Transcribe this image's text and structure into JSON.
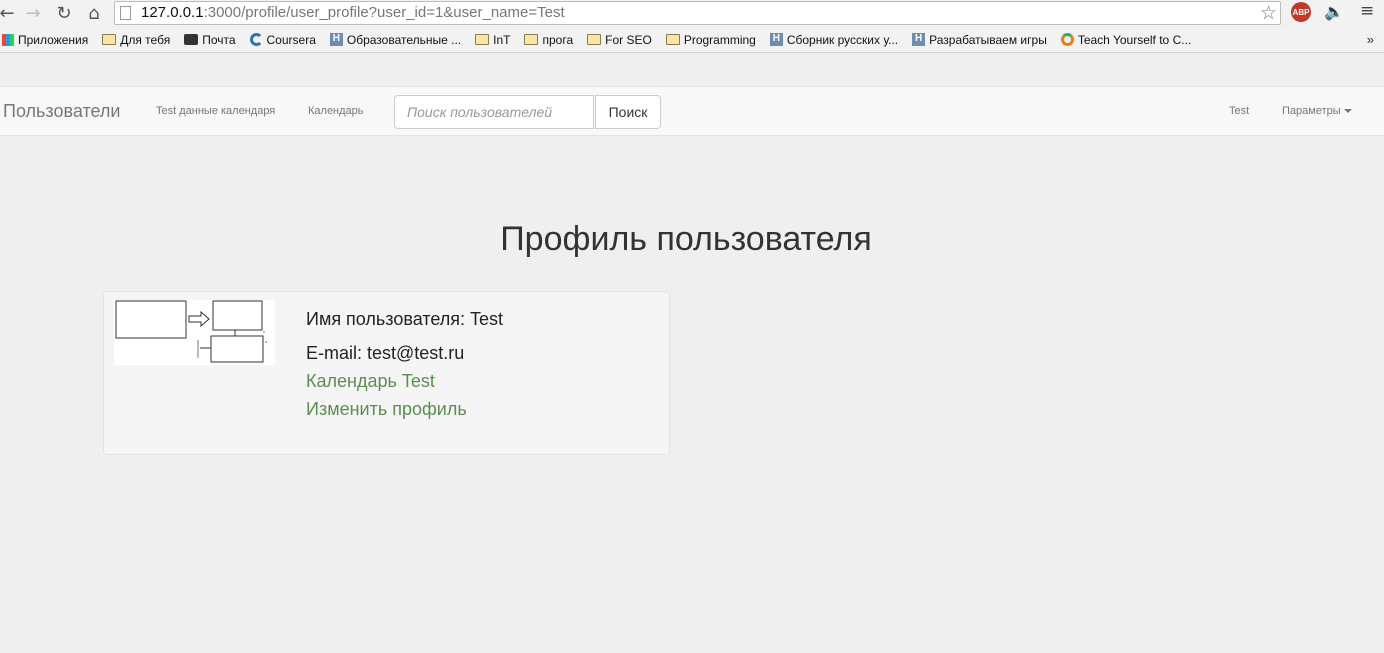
{
  "browser": {
    "url_host": "127.0.0.1",
    "url_rest": ":3000/profile/user_profile?user_id=1&user_name=Test",
    "abp_label": "ABP",
    "more_label": "»",
    "bookmarks": [
      {
        "label": "Приложения",
        "icon": "apps-grid-icon"
      },
      {
        "label": "Для тебя",
        "icon": "folder-icon"
      },
      {
        "label": "Почта",
        "icon": "mail-icon"
      },
      {
        "label": "Coursera",
        "icon": "coursera-icon"
      },
      {
        "label": "Образовательные ...",
        "icon": "habr-icon"
      },
      {
        "label": "InT",
        "icon": "folder-icon"
      },
      {
        "label": "прога",
        "icon": "folder-icon"
      },
      {
        "label": "For SEO",
        "icon": "folder-icon"
      },
      {
        "label": "Programming",
        "icon": "folder-icon"
      },
      {
        "label": "Сборник русских у...",
        "icon": "habr-icon"
      },
      {
        "label": "Разрабатываем игры",
        "icon": "habr-icon"
      },
      {
        "label": "Teach Yourself to C...",
        "icon": "teach-icon"
      }
    ]
  },
  "navbar": {
    "brand": "Пользователи",
    "links": [
      "Test данные календаря",
      "Календарь"
    ],
    "search_placeholder": "Поиск пользователей",
    "search_button": "Поиск",
    "user": "Test",
    "settings": "Параметры"
  },
  "main": {
    "title": "Профиль пользователя",
    "username_line": "Имя пользователя: Test",
    "email_line": "E-mail: test@test.ru",
    "calendar_link": "Календарь Test",
    "edit_link": "Изменить профиль"
  }
}
